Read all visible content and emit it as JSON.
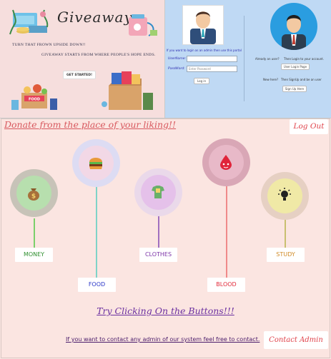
{
  "hero": {
    "title": "Giveaway",
    "tagline1": "TURN THAT FROWN UPSIDE DOWN!!",
    "tagline2": "GIVEAWAY STARTS FROM WHERE PEOPLE'S HOPE ENDS.",
    "start_button": "GET STARTED!",
    "food_box_label": "FOOD"
  },
  "login": {
    "prompt": "If you want to login as an admin then use this portal",
    "username_label": "UserName:",
    "password_label": "PassWord:",
    "password_placeholder": "Enter Password",
    "login_button": "Log in",
    "already_user": "Already an user?",
    "already_user_action": "Then Login to your account.",
    "user_login_button": "User Login Page",
    "new_here": "New here?",
    "new_here_action": "Then SignUp and be an user",
    "signup_button": "Sign Up Here"
  },
  "donate_title": "Donate from the place of your liking!!",
  "logout_button": "Log Out",
  "categories": [
    {
      "label": "MONEY",
      "icon": "money-bag-icon",
      "ring": "#c7c3b8",
      "fill": "#b7dfae",
      "text_color": "#2f8f2f",
      "stick": "#7bd06b"
    },
    {
      "label": "FOOD",
      "icon": "burger-icon",
      "ring": "#dddcf3",
      "fill": "#f2d8e6",
      "text_color": "#2a36c8",
      "stick": "#7fd3c8"
    },
    {
      "label": "CLOTHES",
      "icon": "shirt-icon",
      "ring": "#ead9ea",
      "fill": "#e5c1ea",
      "text_color": "#7d35a8",
      "stick": "#a070c0"
    },
    {
      "label": "BLOOD",
      "icon": "blood-drop-icon",
      "ring": "#d9a7b6",
      "fill": "#e8b9c8",
      "text_color": "#e22a3a",
      "stick": "#f08a8a"
    },
    {
      "label": "STUDY",
      "icon": "lightbulb-icon",
      "ring": "#e6d0c3",
      "fill": "#f0e9a6",
      "text_color": "#d08a25",
      "stick": "#c8c070"
    }
  ],
  "try_text": "Try Clicking On the Buttons!!!",
  "contact_text": "If you want to contact any admin of our system feel free to contact.",
  "contact_button": "Contact Admin"
}
